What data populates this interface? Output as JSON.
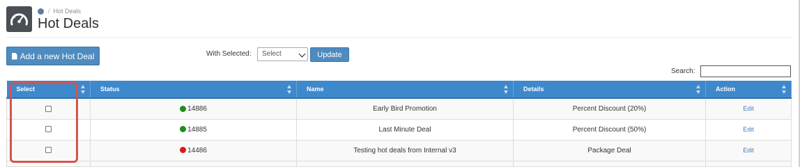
{
  "header": {
    "icon": "speedometer-icon",
    "breadcrumb": {
      "home_icon": "home-icon",
      "separator": "/",
      "current": "Hot Deals"
    },
    "title": "Hot Deals"
  },
  "toolbar": {
    "add_button_icon": "document-icon",
    "add_button_label": "Add a new Hot Deal",
    "with_selected_label": "With Selected:",
    "select_value": "Select",
    "update_label": "Update",
    "search_label": "Search:",
    "search_value": ""
  },
  "table": {
    "columns": [
      "Select",
      "Status",
      "Name",
      "Details",
      "Action"
    ],
    "rows": [
      {
        "status_id": "14886",
        "status_color": "#1e8c1e",
        "name": "Early Bird Promotion",
        "details": "Percent Discount (20%)",
        "action": "Edit"
      },
      {
        "status_id": "14885",
        "status_color": "#1e8c1e",
        "name": "Last Minute Deal",
        "details": "Percent Discount (50%)",
        "action": "Edit"
      },
      {
        "status_id": "14486",
        "status_color": "#e01818",
        "name": "Testing hot deals from Internal v3",
        "details": "Package Deal",
        "action": "Edit"
      }
    ]
  },
  "colors": {
    "accent": "#3e88cc",
    "button": "#4e8bbf",
    "highlight": "#d5544c",
    "active": "#1e8c1e",
    "inactive": "#e01818"
  }
}
